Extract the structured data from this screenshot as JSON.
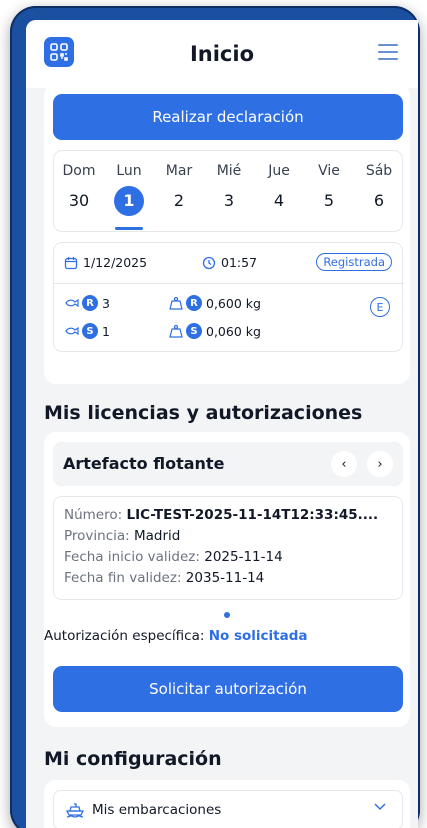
{
  "header": {
    "title": "Inicio"
  },
  "main": {
    "declare_button": "Realizar declaración",
    "week": [
      {
        "name": "Dom",
        "num": "30"
      },
      {
        "name": "Lun",
        "num": "1"
      },
      {
        "name": "Mar",
        "num": "2"
      },
      {
        "name": "Mié",
        "num": "3"
      },
      {
        "name": "Jue",
        "num": "4"
      },
      {
        "name": "Vie",
        "num": "5"
      },
      {
        "name": "Sáb",
        "num": "6"
      }
    ],
    "selected_day_index": 1,
    "declaration": {
      "date": "1/12/2025",
      "time": "01:57",
      "status": "Registrada",
      "fish_r_count": "3",
      "weight_r": "0,600 kg",
      "fish_s_count": "1",
      "weight_s": "0,060 kg",
      "badge_r": "R",
      "badge_s": "S",
      "badge_e": "E"
    }
  },
  "licenses": {
    "section_title": "Mis licencias y autorizaciones",
    "type": "Artefacto flotante",
    "number_label": "Número: ",
    "number_value": "LIC-TEST-2025-11-14T12:33:45....",
    "province_label": "Provincia: ",
    "province_value": "Madrid",
    "start_label": "Fecha inicio validez: ",
    "start_value": "2025-11-14",
    "end_label": "Fecha fin validez: ",
    "end_value": "2035-11-14",
    "auth_label": "Autorización específica: ",
    "auth_value": "No solicitada",
    "request_button": "Solicitar autorización"
  },
  "config": {
    "section_title": "Mi configuración",
    "boats_label": "Mis embarcaciones"
  },
  "colors": {
    "accent": "#2f6fe4",
    "frame": "#1b4fa0",
    "background": "#f3f4f6"
  }
}
